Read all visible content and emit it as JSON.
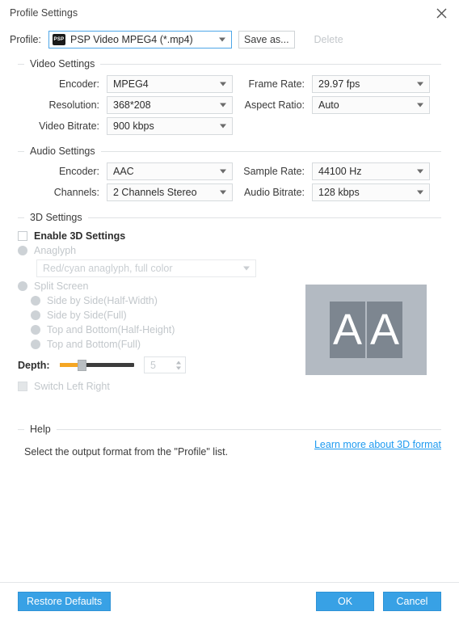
{
  "window": {
    "title": "Profile Settings",
    "close_icon": "close-icon"
  },
  "profile": {
    "label": "Profile:",
    "icon_text": "PSP",
    "value": "PSP Video MPEG4 (*.mp4)",
    "save_as_label": "Save as...",
    "delete_label": "Delete"
  },
  "video": {
    "legend": "Video Settings",
    "encoder_label": "Encoder:",
    "encoder_value": "MPEG4",
    "frame_rate_label": "Frame Rate:",
    "frame_rate_value": "29.97 fps",
    "resolution_label": "Resolution:",
    "resolution_value": "368*208",
    "aspect_ratio_label": "Aspect Ratio:",
    "aspect_ratio_value": "Auto",
    "bitrate_label": "Video Bitrate:",
    "bitrate_value": "900 kbps"
  },
  "audio": {
    "legend": "Audio Settings",
    "encoder_label": "Encoder:",
    "encoder_value": "AAC",
    "sample_rate_label": "Sample Rate:",
    "sample_rate_value": "44100 Hz",
    "channels_label": "Channels:",
    "channels_value": "2 Channels Stereo",
    "audio_bitrate_label": "Audio Bitrate:",
    "audio_bitrate_value": "128 kbps"
  },
  "three_d": {
    "legend": "3D Settings",
    "enable_label": "Enable 3D Settings",
    "anaglyph_label": "Anaglyph",
    "anaglyph_value": "Red/cyan anaglyph, full color",
    "split_screen_label": "Split Screen",
    "split_options": [
      "Side by Side(Half-Width)",
      "Side by Side(Full)",
      "Top and Bottom(Half-Height)",
      "Top and Bottom(Full)"
    ],
    "depth_label": "Depth:",
    "depth_value": "5",
    "switch_label": "Switch Left Right",
    "learn_more_label": "Learn more about 3D format",
    "preview_letter_left": "A",
    "preview_letter_right": "A"
  },
  "help": {
    "legend": "Help",
    "text": "Select the output format from the \"Profile\" list."
  },
  "footer": {
    "restore_label": "Restore Defaults",
    "ok_label": "OK",
    "cancel_label": "Cancel"
  }
}
